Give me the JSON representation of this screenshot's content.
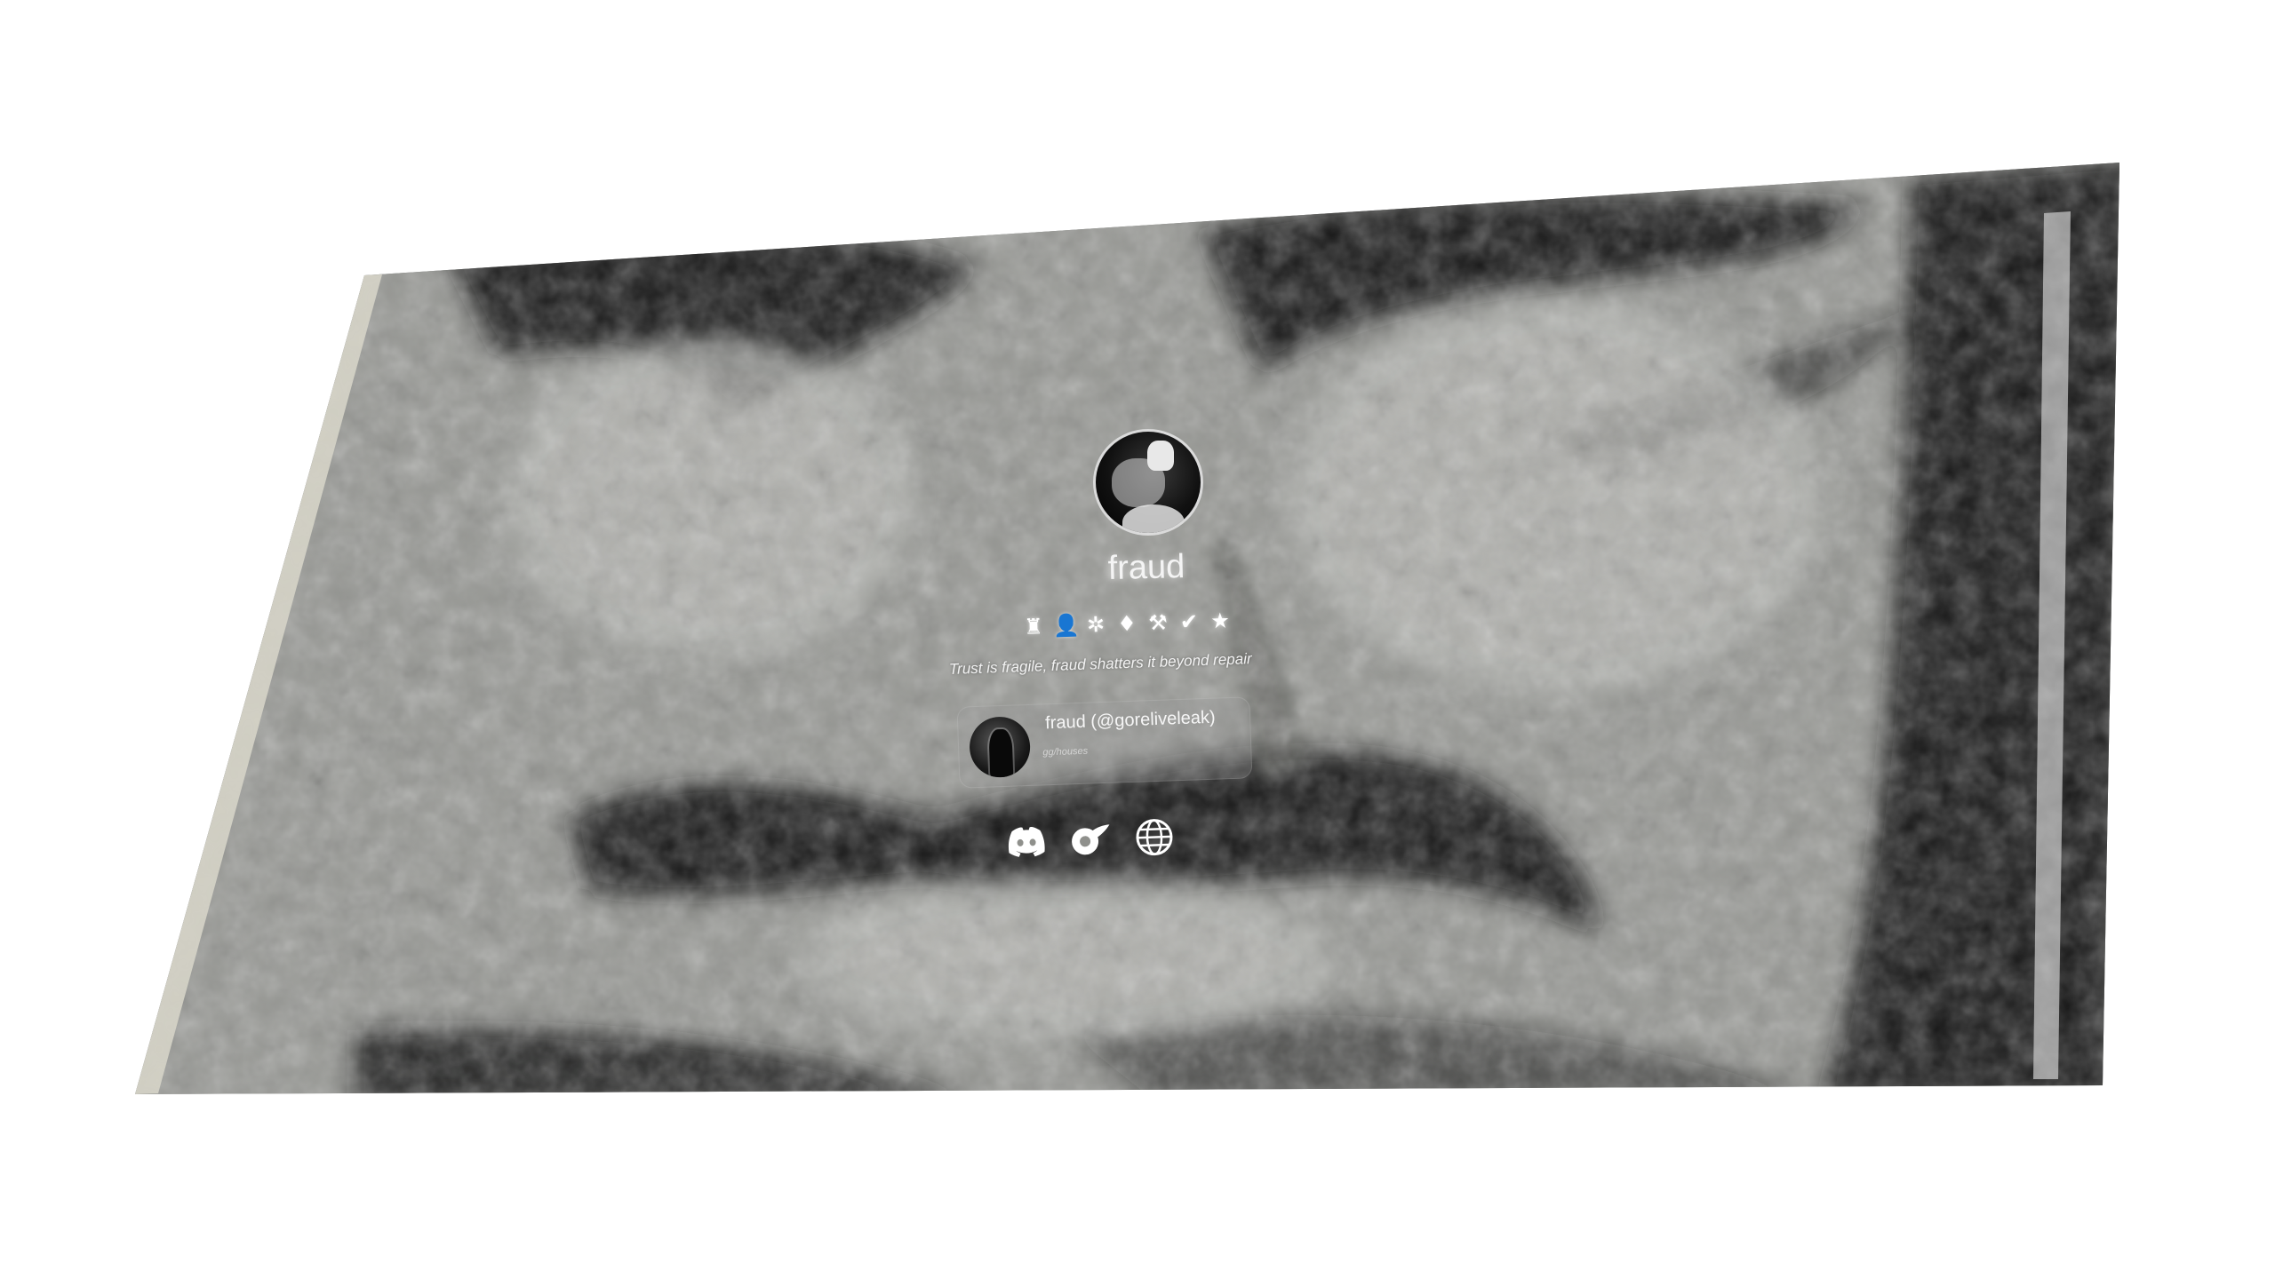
{
  "profile": {
    "username": "fraud",
    "bio": "Trust is fragile, fraud shatters it beyond repair",
    "badges": [
      {
        "icon": "trophy-icon",
        "glyph": "♜"
      },
      {
        "icon": "user-icon",
        "glyph": "👤"
      },
      {
        "icon": "snowflake-icon",
        "glyph": "✲"
      },
      {
        "icon": "gem-icon",
        "glyph": "♦"
      },
      {
        "icon": "wrench-icon",
        "glyph": "⚒"
      },
      {
        "icon": "verified-icon",
        "glyph": "✔"
      },
      {
        "icon": "star-icon",
        "glyph": "★"
      }
    ]
  },
  "discord_presence": {
    "name": "fraud (@goreliveleak)",
    "status": "gg/houses"
  },
  "socials": [
    {
      "icon": "discord-icon"
    },
    {
      "icon": "cashapp-icon"
    },
    {
      "icon": "globe-icon"
    }
  ],
  "colors": {
    "screen_gray": "#8f908c",
    "text_white": "#f4f4f4"
  }
}
